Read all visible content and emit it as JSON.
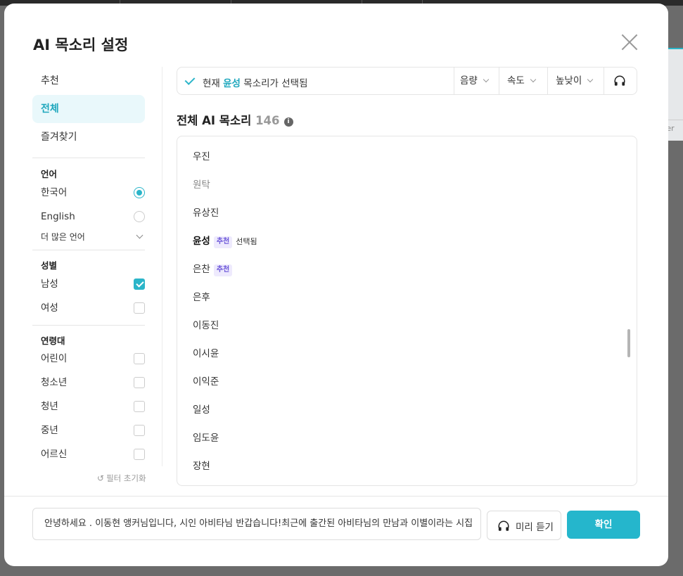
{
  "modal": {
    "title": "AI 목소리 설정"
  },
  "sidebar": {
    "categories": [
      {
        "label": "추천",
        "active": false
      },
      {
        "label": "전체",
        "active": true
      },
      {
        "label": "즐겨찾기",
        "active": false
      }
    ],
    "language": {
      "heading": "언어",
      "options": [
        {
          "label": "한국어",
          "selected": true
        },
        {
          "label": "English",
          "selected": false
        }
      ],
      "more_label": "더 많은 언어"
    },
    "gender": {
      "heading": "성별",
      "options": [
        {
          "label": "남성",
          "checked": true
        },
        {
          "label": "여성",
          "checked": false
        }
      ]
    },
    "age": {
      "heading": "연령대",
      "options": [
        {
          "label": "어린이",
          "checked": false
        },
        {
          "label": "청소년",
          "checked": false
        },
        {
          "label": "청년",
          "checked": false
        },
        {
          "label": "중년",
          "checked": false
        },
        {
          "label": "어르신",
          "checked": false
        }
      ]
    },
    "reset_label": "필터 초기화"
  },
  "status": {
    "prefix": "현재",
    "voice": "윤성",
    "suffix": "목소리가 선택됨",
    "controls": [
      "음량",
      "속도",
      "높낮이"
    ]
  },
  "list": {
    "title": "전체 AI 목소리",
    "count": "146",
    "voices": [
      {
        "name": "우진",
        "badge": "",
        "selected_tag": "",
        "dim": false
      },
      {
        "name": "원탁",
        "badge": "",
        "selected_tag": "",
        "dim": true
      },
      {
        "name": "유상진",
        "badge": "",
        "selected_tag": "",
        "dim": false
      },
      {
        "name": "윤성",
        "badge": "추천",
        "selected_tag": "선택됨",
        "dim": false
      },
      {
        "name": "은찬",
        "badge": "추천",
        "selected_tag": "",
        "dim": false
      },
      {
        "name": "은후",
        "badge": "",
        "selected_tag": "",
        "dim": false
      },
      {
        "name": "이동진",
        "badge": "",
        "selected_tag": "",
        "dim": false
      },
      {
        "name": "이시윤",
        "badge": "",
        "selected_tag": "",
        "dim": false
      },
      {
        "name": "이익준",
        "badge": "",
        "selected_tag": "",
        "dim": false
      },
      {
        "name": "일성",
        "badge": "",
        "selected_tag": "",
        "dim": false
      },
      {
        "name": "임도윤",
        "badge": "",
        "selected_tag": "",
        "dim": false
      },
      {
        "name": "장현",
        "badge": "",
        "selected_tag": "",
        "dim": false
      }
    ]
  },
  "footer": {
    "text_value": "안녕하세요 . 이동현 앵커님입니다,  시인 아비타님 반갑습니다!최근에 출간된 아비타님의 만남과 이별이라는 시집",
    "preview_label": "미리 듣기",
    "confirm_label": "확인"
  },
  "colors": {
    "accent": "#25b6cc",
    "badge_bg": "#eeeafd",
    "badge_text": "#6a55d8"
  },
  "background": {
    "right_panel_text": "inter"
  }
}
